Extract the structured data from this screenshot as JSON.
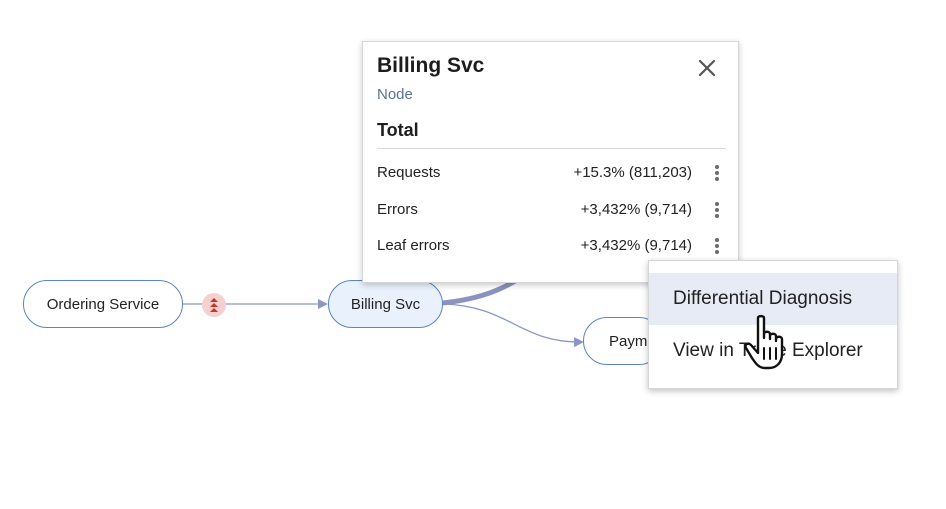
{
  "graph": {
    "nodes": {
      "ordering": {
        "label": "Ordering Service"
      },
      "billing": {
        "label": "Billing Svc",
        "selected": true
      },
      "payment": {
        "label": "Payment Service"
      }
    },
    "anomaly_icon": "triple-chevron-up-icon",
    "colors": {
      "node_border": "#5b83c6",
      "selected_fill": "#e9f2fc",
      "edge": "#8a96c4",
      "anomaly_bg": "#f6cfcf",
      "anomaly_fg": "#c0392b"
    }
  },
  "popover": {
    "title": "Billing Svc",
    "subtitle": "Node",
    "section": "Total",
    "close_icon": "close-icon",
    "metrics": [
      {
        "label": "Requests",
        "value": "+15.3% (811,203)"
      },
      {
        "label": "Errors",
        "value": "+3,432% (9,714)"
      },
      {
        "label": "Leaf errors",
        "value": "+3,432% (9,714)"
      }
    ]
  },
  "context_menu": {
    "items": [
      {
        "label": "Differential Diagnosis",
        "highlighted": true
      },
      {
        "label": "View in Trace Explorer"
      }
    ],
    "highlight_color": "#e6ebf5"
  },
  "cursor_icon": "hand-pointer-icon"
}
